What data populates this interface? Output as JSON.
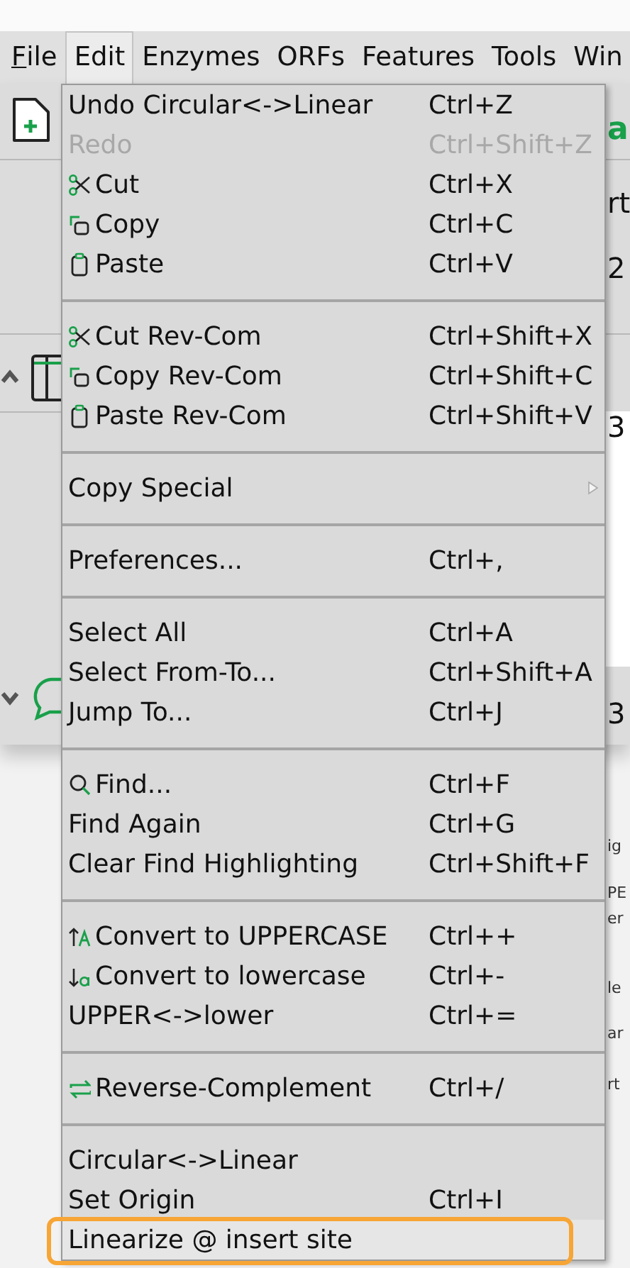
{
  "menubar": [
    {
      "label": "File",
      "selected": false,
      "mnemonic": true
    },
    {
      "label": "Edit",
      "selected": true,
      "mnemonic": false
    },
    {
      "label": "Enzymes",
      "selected": false,
      "mnemonic": false
    },
    {
      "label": "ORFs",
      "selected": false,
      "mnemonic": false
    },
    {
      "label": "Features",
      "selected": false,
      "mnemonic": false
    },
    {
      "label": "Tools",
      "selected": false,
      "mnemonic": false
    },
    {
      "label": "Win",
      "selected": false,
      "mnemonic": false
    }
  ],
  "edit_menu": [
    [
      {
        "kind": "plain",
        "label": "Undo Circular<->Linear",
        "shortcut": "Ctrl+Z",
        "disabled": false
      },
      {
        "kind": "plain",
        "label": "Redo",
        "shortcut": "Ctrl+Shift+Z",
        "disabled": true
      },
      {
        "kind": "scissors",
        "label": "Cut",
        "shortcut": "Ctrl+X",
        "disabled": false
      },
      {
        "kind": "copy",
        "label": "Copy",
        "shortcut": "Ctrl+C",
        "disabled": false
      },
      {
        "kind": "paste",
        "label": "Paste",
        "shortcut": "Ctrl+V",
        "disabled": false
      }
    ],
    [
      {
        "kind": "scissors",
        "label": "Cut Rev-Com",
        "shortcut": "Ctrl+Shift+X",
        "disabled": false
      },
      {
        "kind": "copy",
        "label": "Copy Rev-Com",
        "shortcut": "Ctrl+Shift+C",
        "disabled": false
      },
      {
        "kind": "paste",
        "label": "Paste Rev-Com",
        "shortcut": "Ctrl+Shift+V",
        "disabled": false
      }
    ],
    [
      {
        "kind": "submenu",
        "label": "Copy Special",
        "disabled": false
      }
    ],
    [
      {
        "kind": "plain",
        "label": "Preferences...",
        "shortcut": "Ctrl+,",
        "disabled": false
      }
    ],
    [
      {
        "kind": "plain",
        "label": "Select All",
        "shortcut": "Ctrl+A",
        "disabled": false
      },
      {
        "kind": "plain",
        "label": "Select From-To...",
        "shortcut": "Ctrl+Shift+A",
        "disabled": false
      },
      {
        "kind": "plain",
        "label": "Jump To...",
        "shortcut": "Ctrl+J",
        "disabled": false
      }
    ],
    [
      {
        "kind": "find",
        "label": "Find...",
        "shortcut": "Ctrl+F",
        "disabled": false
      },
      {
        "kind": "plain",
        "label": "Find Again",
        "shortcut": "Ctrl+G",
        "disabled": false
      },
      {
        "kind": "plain",
        "label": "Clear Find Highlighting",
        "shortcut": "Ctrl+Shift+F",
        "disabled": false
      }
    ],
    [
      {
        "kind": "upper",
        "label": "Convert to UPPERCASE",
        "shortcut": "Ctrl++",
        "disabled": false
      },
      {
        "kind": "lower",
        "label": "Convert to lowercase",
        "shortcut": "Ctrl+-",
        "disabled": false
      },
      {
        "kind": "plain",
        "label": "UPPER<->lower",
        "shortcut": "Ctrl+=",
        "disabled": false
      }
    ],
    [
      {
        "kind": "swap",
        "label": "Reverse-Complement",
        "shortcut": "Ctrl+/",
        "disabled": false
      }
    ],
    [
      {
        "kind": "plain",
        "label": "Circular<->Linear",
        "disabled": false
      },
      {
        "kind": "plain",
        "label": "Set Origin",
        "shortcut": "Ctrl+I",
        "disabled": false
      },
      {
        "kind": "plain",
        "label": "Linearize @ insert site",
        "disabled": false,
        "annotated": true
      }
    ]
  ],
  "background_fragments": [
    {
      "text": "a",
      "kind": "green"
    },
    {
      "text": "rt",
      "kind": "large"
    },
    {
      "text": "2",
      "kind": "large"
    },
    {
      "text": "3",
      "kind": "large"
    },
    {
      "text": "3",
      "kind": "large"
    },
    {
      "text": "ig",
      "kind": "small"
    },
    {
      "text": "PE",
      "kind": "small"
    },
    {
      "text": "er",
      "kind": "small"
    },
    {
      "text": "le",
      "kind": "small"
    },
    {
      "text": "ar",
      "kind": "small"
    },
    {
      "text": "rt",
      "kind": "small"
    }
  ]
}
